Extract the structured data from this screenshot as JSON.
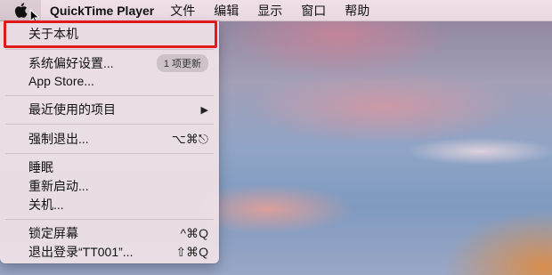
{
  "menubar": {
    "app_name": "QuickTime Player",
    "menus": [
      "文件",
      "编辑",
      "显示",
      "窗口",
      "帮助"
    ]
  },
  "apple_menu": {
    "about": "关于本机",
    "system_prefs": "系统偏好设置...",
    "updates_badge": "1 项更新",
    "app_store": "App Store...",
    "recent_items": "最近使用的项目",
    "recent_arrow": "▶",
    "force_quit": "强制退出...",
    "force_quit_shortcut": "⌥⌘⎋",
    "sleep": "睡眠",
    "restart": "重新启动...",
    "shutdown": "关机...",
    "lock_screen": "锁定屏幕",
    "lock_shortcut": "^⌘Q",
    "logout": "退出登录“TT001”...",
    "logout_shortcut": "⇧⌘Q"
  },
  "colors": {
    "highlight_border": "#e01a1a",
    "menubar_bg": "#ecdbe3"
  }
}
